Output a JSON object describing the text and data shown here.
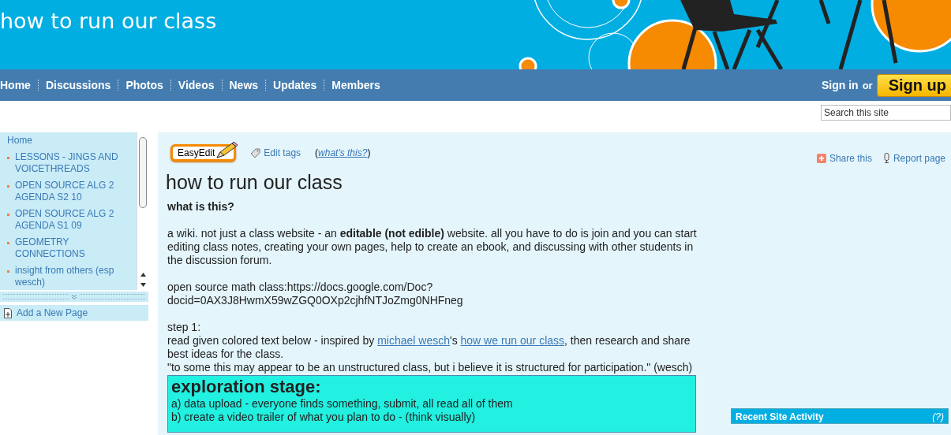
{
  "site_title": "how to run our class",
  "nav": [
    {
      "label": "Home"
    },
    {
      "label": "Discussions"
    },
    {
      "label": "Photos"
    },
    {
      "label": "Videos"
    },
    {
      "label": "News"
    },
    {
      "label": "Updates"
    },
    {
      "label": "Members"
    }
  ],
  "account": {
    "sign_in": "Sign in",
    "or": "or",
    "sign_up": "Sign up"
  },
  "search": {
    "placeholder": "Search this site"
  },
  "sidebar": {
    "items": [
      {
        "label": "Home",
        "kind": "plain"
      },
      {
        "label": "LESSONS - JINGS AND VOICETHREADS",
        "kind": "bullet"
      },
      {
        "label": "OPEN SOURCE ALG 2 AGENDA S2 10",
        "kind": "bullet"
      },
      {
        "label": "OPEN SOURCE ALG 2 AGENDA S1 09",
        "kind": "bullet"
      },
      {
        "label": "GEOMETRY CONNECTIONS",
        "kind": "bullet"
      },
      {
        "label": "insight from others (esp wesch)",
        "kind": "bullet"
      }
    ],
    "add_page": "Add a New Page"
  },
  "toolbar": {
    "easy_edit": "EasyEdit",
    "edit_tags": "Edit tags",
    "whats_this_open": "(",
    "whats_this": "what's this?",
    "whats_this_close": ")",
    "share": "Share this",
    "report": "Report page"
  },
  "page": {
    "title": "how to run our class",
    "blocks": [
      {
        "kind": "heading",
        "text": "what is this?"
      },
      {
        "kind": "para",
        "text": "a wiki. not just a class website - an **editable (not edible)** website. all you have to do is join and you can start editing class notes, creating your own pages, help to create an ebook, and discussing with other students in the discussion forum."
      },
      {
        "kind": "lines",
        "lines": [
          "open source math class:https://docs.google.com/Doc?",
          "docid=0AX3J8HwmX59wZGQ0OXp2cjhfNTJoZmg0NHFneg"
        ]
      },
      {
        "kind": "step",
        "text": "step 1:",
        "parts": [
          {
            "kind": "text",
            "text": "read given colored text below - inspired by "
          },
          {
            "kind": "link",
            "text": "michael wesch"
          },
          {
            "kind": "text",
            "text": "'s "
          },
          {
            "kind": "link",
            "text": "how we run our class"
          },
          {
            "kind": "text",
            "text": ", then research and share best ideas for the class."
          }
        ],
        "quote": "\"to some this may appear to be an unstructured class, but i believe it is structured for participation.\" (wesch)"
      },
      {
        "kind": "box",
        "title": "exploration stage:",
        "lines": [
          "a) data upload - everyone finds something, submit, all read all of them",
          "b) create a video trailer of what you plan to do - (think visually)"
        ]
      }
    ]
  },
  "activity": {
    "title": "Recent Site Activity",
    "help": "(?)"
  }
}
